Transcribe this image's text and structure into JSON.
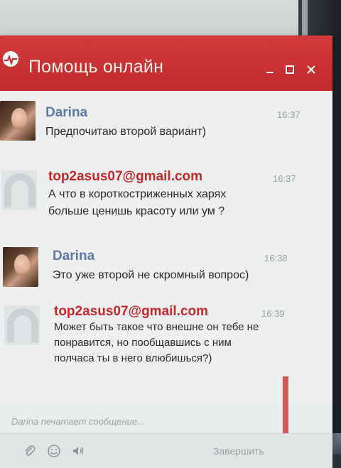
{
  "window": {
    "title": "Помощь онлайн",
    "icons": [
      "chat-logo-icon",
      "minimize-icon",
      "maximize-icon",
      "close-icon"
    ],
    "accent_color": "#c8302f"
  },
  "messages": [
    {
      "sender": "Darina",
      "time": "16:37",
      "text": "Предпочитаю второй вариант)"
    },
    {
      "sender": "top2asus07@gmail.com",
      "time": "16:37",
      "text": "А что в короткостриженных харях\nбольше ценишь красоту или ум ?"
    },
    {
      "sender": "Darina",
      "time": "16:38",
      "text": "Это уже второй не скромный вопрос)"
    },
    {
      "sender": "top2asus07@gmail.com",
      "time": "16:39",
      "text": "Может быть такое что внешне он тебе не\nпонравится, но пообщавшись с ним\nполчаса ты в него влюбишься?)"
    }
  ],
  "status": {
    "typing": "Darina печатает сообщение..."
  },
  "toolbar": {
    "finish_label": "Завершить",
    "icons": [
      "paperclip-icon",
      "smile-icon",
      "speaker-icon"
    ]
  }
}
